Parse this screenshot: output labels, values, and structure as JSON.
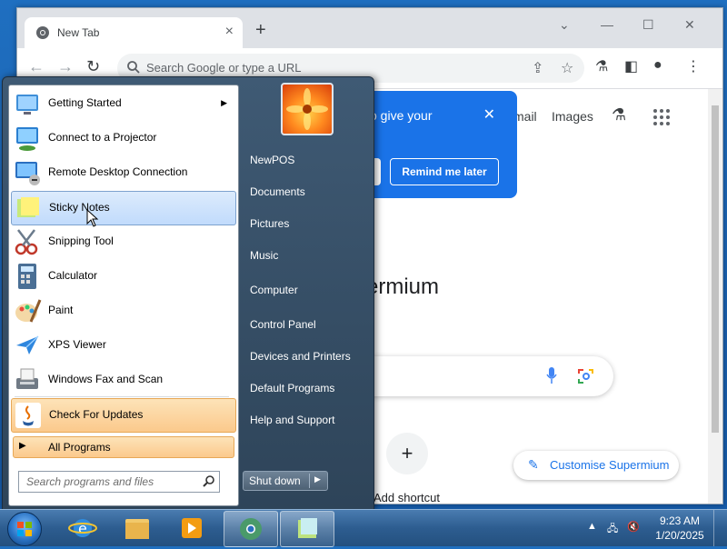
{
  "browser": {
    "tab_title": "New Tab",
    "omnibox_placeholder": "Search Google or type a URL",
    "top_links": [
      "mail",
      "Images"
    ],
    "popup": {
      "text": "o give your",
      "remind_label": "Remind me later"
    },
    "brand_partial": "ermium",
    "add_shortcut_label": "Add shortcut",
    "customise_label": "Customise Supermium"
  },
  "start_menu": {
    "programs": [
      {
        "label": "Getting Started",
        "icon": "getting-started-icon",
        "has_submenu": true
      },
      {
        "label": "Connect to a Projector",
        "icon": "projector-icon"
      },
      {
        "label": "Remote Desktop Connection",
        "icon": "remote-desktop-icon"
      },
      {
        "label": "Sticky Notes",
        "icon": "sticky-notes-icon",
        "highlighted": true
      },
      {
        "label": "Snipping Tool",
        "icon": "scissors-icon"
      },
      {
        "label": "Calculator",
        "icon": "calculator-icon"
      },
      {
        "label": "Paint",
        "icon": "paint-icon"
      },
      {
        "label": "XPS Viewer",
        "icon": "xps-viewer-icon"
      },
      {
        "label": "Windows Fax and Scan",
        "icon": "fax-icon"
      },
      {
        "label": "Check For Updates",
        "icon": "java-icon",
        "highlighted": true
      }
    ],
    "all_programs_label": "All Programs",
    "search_placeholder": "Search programs and files",
    "right_items": [
      "NewPOS",
      "Documents",
      "Pictures",
      "Music",
      "Computer",
      "Control Panel",
      "Devices and Printers",
      "Default Programs",
      "Help and Support"
    ],
    "shutdown_label": "Shut down"
  },
  "taskbar": {
    "time": "9:23 AM",
    "date": "1/20/2025"
  }
}
